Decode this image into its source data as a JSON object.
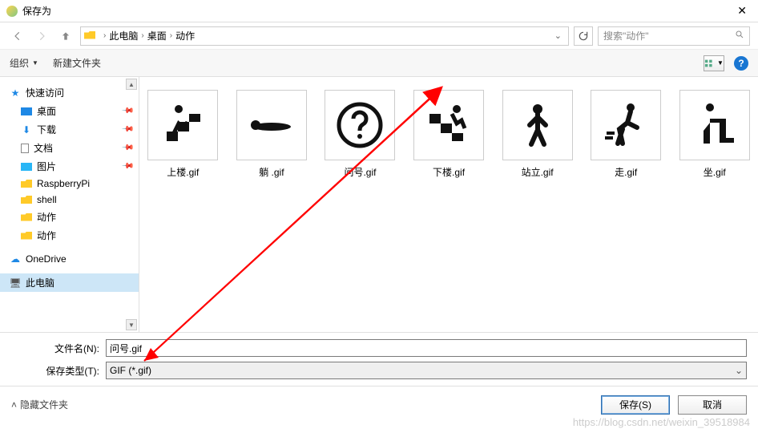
{
  "window": {
    "title": "保存为"
  },
  "nav": {
    "crumbs": [
      "此电脑",
      "桌面",
      "动作"
    ],
    "search_placeholder": "搜索\"动作\""
  },
  "toolbar": {
    "organize": "组织",
    "new_folder": "新建文件夹"
  },
  "sidebar": {
    "quick_access": "快速访问",
    "items": [
      {
        "label": "桌面",
        "pinned": true,
        "kind": "desktop"
      },
      {
        "label": "下载",
        "pinned": true,
        "kind": "download"
      },
      {
        "label": "文档",
        "pinned": true,
        "kind": "doc"
      },
      {
        "label": "图片",
        "pinned": true,
        "kind": "pic"
      },
      {
        "label": "RaspberryPi",
        "pinned": false,
        "kind": "folder"
      },
      {
        "label": "shell",
        "pinned": false,
        "kind": "folder"
      },
      {
        "label": "动作",
        "pinned": false,
        "kind": "folder"
      },
      {
        "label": "动作",
        "pinned": false,
        "kind": "folder"
      }
    ],
    "onedrive": "OneDrive",
    "this_pc": "此电脑"
  },
  "files": [
    {
      "label": "上楼.gif",
      "icon": "stairs-up"
    },
    {
      "label": "躺 .gif",
      "icon": "lying"
    },
    {
      "label": "问号.gif",
      "icon": "question"
    },
    {
      "label": "下楼.gif",
      "icon": "stairs-down"
    },
    {
      "label": "站立.gif",
      "icon": "standing"
    },
    {
      "label": "走.gif",
      "icon": "walking"
    },
    {
      "label": "坐.gif",
      "icon": "sitting"
    }
  ],
  "fields": {
    "filename_label": "文件名(N):",
    "filename_value": "问号.gif",
    "type_label": "保存类型(T):",
    "type_value": "GIF (*.gif)"
  },
  "footer": {
    "hide_folders": "隐藏文件夹",
    "save": "保存(S)",
    "cancel": "取消"
  },
  "watermark": "https://blog.csdn.net/weixin_39518984"
}
